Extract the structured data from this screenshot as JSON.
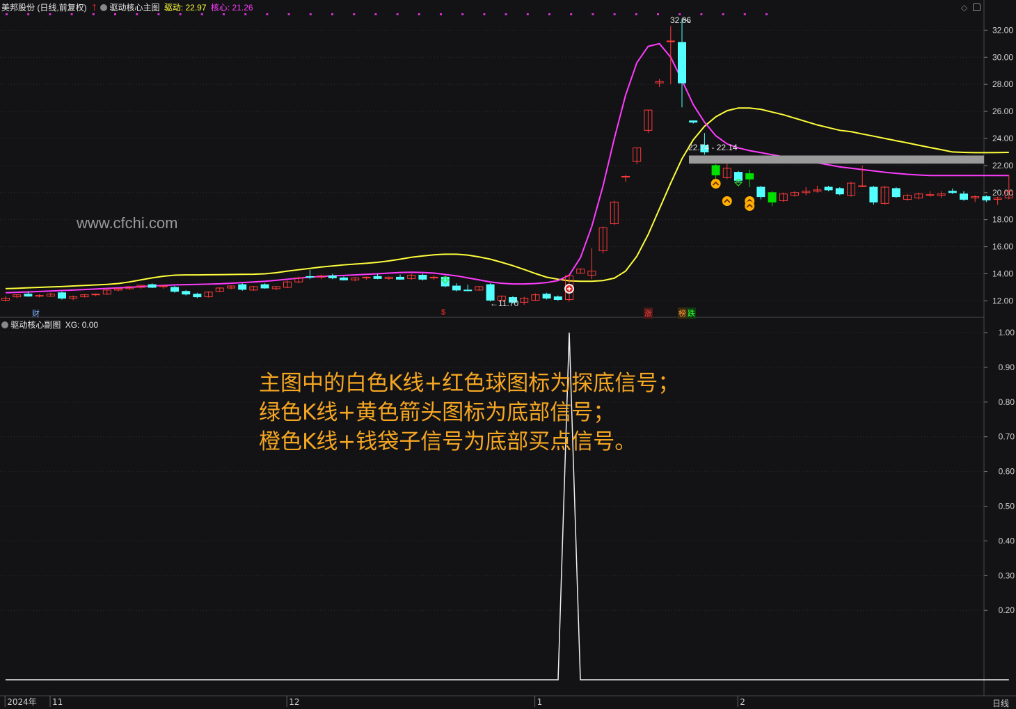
{
  "main_header": {
    "stock": "美邦股份 (日线,前复权)",
    "indicator": "驱动核心主图",
    "drive_label": "驱动: 22.97",
    "core_label": "核心: 21.26"
  },
  "sub_header": {
    "indicator": "驱动核心副图",
    "xg_label": "XG: 0.00"
  },
  "watermark": "www.cfchi.com",
  "annotations": {
    "high": "32.86",
    "low": "←11.70",
    "range": "22.74 - 22.14"
  },
  "event_labels": {
    "cai": "财",
    "dollar": "$",
    "zhang": "涨",
    "bang": "榜",
    "die": "跌"
  },
  "instruction_text": [
    "主图中的白色K线+红色球图标为探底信号；",
    "绿色K线+黄色箭头图标为底部信号；",
    "橙色K线+钱袋子信号为底部买点信号。"
  ],
  "period_label": "日线",
  "colors": {
    "background": "#131315",
    "up_candle": "#ff3b3b",
    "down_candle": "#54ffff",
    "drive_line": "#ffff3c",
    "core_line": "#ff3cff",
    "signal_green": "#00e000",
    "annotation_text": "#f5a623"
  },
  "chart_data": [
    {
      "type": "candlestick",
      "title": "驱动核心主图",
      "y_ticks": [
        "32.00",
        "30.00",
        "28.00",
        "26.00",
        "24.00",
        "22.00",
        "20.00",
        "18.00",
        "16.00",
        "14.00",
        "12.00"
      ],
      "ylim": [
        11.2,
        33.2
      ],
      "x_labels": [
        "2024年",
        "11",
        "12",
        "1",
        "2"
      ],
      "ohlc": [
        [
          12.05,
          12.35,
          11.95,
          12.2
        ],
        [
          12.3,
          12.5,
          12.2,
          12.45
        ],
        [
          12.5,
          12.7,
          12.3,
          12.35
        ],
        [
          12.4,
          12.5,
          12.25,
          12.4
        ],
        [
          12.35,
          12.6,
          12.3,
          12.5
        ],
        [
          12.6,
          12.7,
          12.1,
          12.2
        ],
        [
          12.2,
          12.4,
          12.05,
          12.3
        ],
        [
          12.3,
          12.5,
          12.25,
          12.45
        ],
        [
          12.45,
          12.55,
          12.35,
          12.5
        ],
        [
          12.5,
          12.85,
          12.45,
          12.8
        ],
        [
          12.8,
          12.95,
          12.7,
          12.9
        ],
        [
          12.9,
          13.1,
          12.8,
          13.05
        ],
        [
          13.0,
          13.2,
          12.9,
          13.15
        ],
        [
          13.2,
          13.3,
          12.95,
          13.0
        ],
        [
          13.05,
          13.2,
          12.9,
          13.1
        ],
        [
          13.0,
          13.1,
          12.6,
          12.7
        ],
        [
          12.7,
          12.8,
          12.4,
          12.5
        ],
        [
          12.5,
          12.6,
          12.2,
          12.3
        ],
        [
          12.3,
          12.7,
          12.25,
          12.65
        ],
        [
          12.7,
          13.0,
          12.65,
          12.95
        ],
        [
          12.95,
          13.15,
          12.85,
          13.1
        ],
        [
          13.2,
          13.3,
          12.75,
          12.85
        ],
        [
          12.8,
          13.1,
          12.75,
          13.05
        ],
        [
          13.2,
          13.3,
          12.9,
          12.95
        ],
        [
          12.9,
          13.1,
          12.8,
          13.05
        ],
        [
          13.0,
          13.5,
          12.95,
          13.4
        ],
        [
          13.4,
          13.8,
          13.3,
          13.7
        ],
        [
          13.8,
          14.3,
          13.6,
          13.75
        ],
        [
          13.75,
          13.95,
          13.6,
          13.85
        ],
        [
          13.85,
          14.0,
          13.6,
          13.7
        ],
        [
          13.7,
          13.8,
          13.5,
          13.55
        ],
        [
          13.55,
          13.75,
          13.45,
          13.7
        ],
        [
          13.7,
          13.8,
          13.55,
          13.75
        ],
        [
          13.8,
          14.0,
          13.6,
          13.65
        ],
        [
          13.65,
          13.8,
          13.55,
          13.75
        ],
        [
          13.75,
          13.95,
          13.55,
          13.6
        ],
        [
          13.65,
          14.0,
          13.55,
          13.9
        ],
        [
          13.9,
          14.0,
          13.5,
          13.6
        ],
        [
          13.7,
          13.9,
          13.55,
          13.75
        ],
        [
          13.75,
          13.85,
          13.0,
          13.1
        ],
        [
          13.1,
          13.3,
          12.7,
          12.8
        ],
        [
          12.8,
          13.2,
          12.7,
          12.75
        ],
        [
          12.8,
          13.1,
          12.75,
          13.05
        ],
        [
          13.2,
          13.3,
          11.95,
          12.05
        ],
        [
          12.05,
          12.4,
          12.0,
          12.35
        ],
        [
          12.25,
          12.35,
          11.8,
          11.9
        ],
        [
          11.9,
          12.3,
          11.7,
          12.2
        ],
        [
          12.05,
          12.55,
          12.0,
          12.45
        ],
        [
          12.5,
          12.6,
          12.1,
          12.2
        ],
        [
          12.3,
          12.4,
          12.0,
          12.1
        ],
        [
          12.1,
          13.9,
          11.95,
          13.85
        ],
        [
          14.05,
          14.4,
          14.05,
          14.35
        ],
        [
          13.9,
          15.9,
          13.6,
          14.2
        ],
        [
          15.7,
          17.5,
          15.5,
          17.4
        ],
        [
          17.7,
          19.4,
          17.6,
          19.3
        ],
        [
          21.2,
          21.3,
          20.8,
          21.2
        ],
        [
          22.3,
          23.3,
          22.1,
          23.3
        ],
        [
          24.6,
          26.1,
          24.4,
          26.1
        ],
        [
          28.1,
          28.4,
          27.8,
          28.2
        ],
        [
          31.2,
          32.3,
          28.0,
          31.2
        ],
        [
          31.1,
          32.86,
          26.3,
          28.1
        ],
        [
          25.3,
          25.3,
          25.1,
          25.2
        ],
        [
          23.5,
          24.4,
          22.8,
          23.0
        ],
        [
          22.0,
          22.1,
          20.8,
          21.3
        ],
        [
          21.1,
          22.2,
          21.0,
          21.8
        ],
        [
          21.5,
          21.6,
          20.7,
          20.9
        ],
        [
          21.4,
          21.7,
          20.4,
          21.0
        ],
        [
          20.4,
          20.5,
          19.5,
          19.7
        ],
        [
          20.0,
          20.1,
          19.0,
          19.3
        ],
        [
          19.4,
          20.0,
          19.3,
          19.9
        ],
        [
          19.8,
          20.1,
          19.7,
          20.0
        ],
        [
          20.0,
          20.4,
          19.8,
          20.1
        ],
        [
          20.1,
          20.5,
          20.0,
          20.2
        ],
        [
          20.4,
          20.5,
          20.1,
          20.2
        ],
        [
          20.3,
          20.4,
          19.8,
          19.9
        ],
        [
          19.8,
          20.8,
          19.7,
          20.7
        ],
        [
          20.5,
          22.0,
          20.4,
          20.5
        ],
        [
          20.4,
          20.5,
          19.1,
          19.3
        ],
        [
          19.2,
          20.5,
          19.1,
          20.4
        ],
        [
          20.3,
          20.4,
          19.6,
          19.7
        ],
        [
          19.5,
          19.9,
          19.4,
          19.8
        ],
        [
          19.6,
          20.0,
          19.5,
          19.9
        ],
        [
          19.85,
          20.1,
          19.7,
          19.85
        ],
        [
          19.8,
          20.1,
          19.6,
          19.9
        ],
        [
          20.1,
          20.3,
          19.9,
          20.0
        ],
        [
          19.9,
          20.1,
          19.4,
          19.5
        ],
        [
          19.6,
          19.8,
          19.3,
          19.7
        ],
        [
          19.7,
          19.8,
          19.3,
          19.45
        ],
        [
          19.5,
          19.7,
          19.1,
          19.6
        ],
        [
          19.6,
          21.3,
          19.5,
          20.1
        ]
      ],
      "series": [
        {
          "name": "驱动",
          "values": [
            12.9,
            12.93,
            12.97,
            13.0,
            13.03,
            13.06,
            13.1,
            13.14,
            13.18,
            13.22,
            13.28,
            13.4,
            13.55,
            13.7,
            13.82,
            13.9,
            13.92,
            13.92,
            13.93,
            13.94,
            13.95,
            13.96,
            13.97,
            14.0,
            14.08,
            14.2,
            14.3,
            14.4,
            14.5,
            14.58,
            14.66,
            14.72,
            14.78,
            14.85,
            14.95,
            15.08,
            15.22,
            15.32,
            15.4,
            15.45,
            15.45,
            15.38,
            15.25,
            15.08,
            14.85,
            14.6,
            14.32,
            14.02,
            13.75,
            13.6,
            13.48,
            13.45,
            13.45,
            13.5,
            13.68,
            14.2,
            15.3,
            16.9,
            18.8,
            20.7,
            22.5,
            23.9,
            24.9,
            25.6,
            26.05,
            26.25,
            26.25,
            26.15,
            25.95,
            25.75,
            25.5,
            25.25,
            25.0,
            24.8,
            24.6,
            24.5,
            24.33,
            24.17,
            24.0,
            23.83,
            23.67,
            23.5,
            23.33,
            23.17,
            23.0,
            22.97,
            22.95,
            22.95,
            22.96,
            22.97
          ]
        },
        {
          "name": "核心",
          "values": [
            12.6,
            12.63,
            12.66,
            12.7,
            12.73,
            12.77,
            12.8,
            12.84,
            12.88,
            12.92,
            12.96,
            13.0,
            13.05,
            13.1,
            13.14,
            13.18,
            13.2,
            13.22,
            13.24,
            13.26,
            13.3,
            13.35,
            13.4,
            13.45,
            13.52,
            13.6,
            13.68,
            13.75,
            13.8,
            13.85,
            13.88,
            13.92,
            13.96,
            14.0,
            14.05,
            14.1,
            14.12,
            14.1,
            14.05,
            13.95,
            13.85,
            13.7,
            13.55,
            13.4,
            13.3,
            13.25,
            13.25,
            13.28,
            13.35,
            13.5,
            13.9,
            15.2,
            17.5,
            20.5,
            24.0,
            27.2,
            29.6,
            30.8,
            31.0,
            30.0,
            28.3,
            26.5,
            25.2,
            24.2,
            23.6,
            23.3,
            23.1,
            22.95,
            22.8,
            22.65,
            22.5,
            22.35,
            22.2,
            22.05,
            21.9,
            21.8,
            21.7,
            21.6,
            21.5,
            21.42,
            21.35,
            21.3,
            21.26,
            21.26,
            21.26,
            21.26,
            21.26,
            21.26,
            21.26,
            21.26
          ]
        }
      ]
    },
    {
      "type": "line",
      "title": "驱动核心副图",
      "y_ticks": [
        "1.00",
        "0.90",
        "0.80",
        "0.70",
        "0.60",
        "0.50",
        "0.40",
        "0.30",
        "0.20"
      ],
      "ylim": [
        -0.03,
        1.0
      ],
      "series": [
        {
          "name": "XG",
          "values": [
            0,
            0,
            0,
            0,
            0,
            0,
            0,
            0,
            0,
            0,
            0,
            0,
            0,
            0,
            0,
            0,
            0,
            0,
            0,
            0,
            0,
            0,
            0,
            0,
            0,
            0,
            0,
            0,
            0,
            0,
            0,
            0,
            0,
            0,
            0,
            0,
            0,
            0,
            0,
            0,
            0,
            0,
            0,
            0,
            0,
            0,
            0,
            0,
            0,
            0,
            1,
            0,
            0,
            0,
            0,
            0,
            0,
            0,
            0,
            0,
            0,
            0,
            0,
            0,
            0,
            0,
            0,
            0,
            0,
            0,
            0,
            0,
            0,
            0,
            0,
            0,
            0,
            0,
            0,
            0,
            0,
            0,
            0,
            0,
            0,
            0,
            0,
            0,
            0,
            0
          ]
        }
      ]
    }
  ]
}
